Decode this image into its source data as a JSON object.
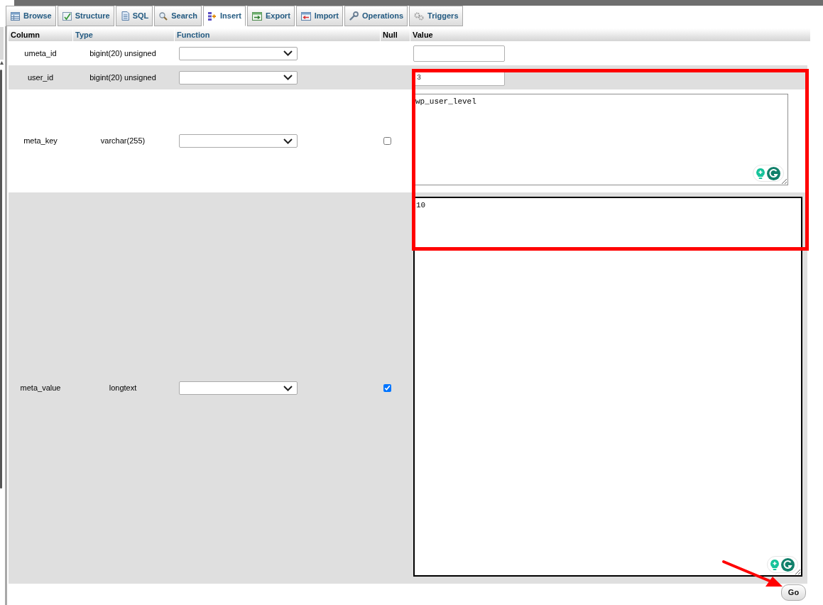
{
  "tabs": [
    {
      "label": "Browse",
      "selected": false
    },
    {
      "label": "Structure",
      "selected": false
    },
    {
      "label": "SQL",
      "selected": false
    },
    {
      "label": "Search",
      "selected": false
    },
    {
      "label": "Insert",
      "selected": true
    },
    {
      "label": "Export",
      "selected": false
    },
    {
      "label": "Import",
      "selected": false
    },
    {
      "label": "Operations",
      "selected": false
    },
    {
      "label": "Triggers",
      "selected": false
    }
  ],
  "table": {
    "columns": [
      {
        "label": "Column",
        "link": false
      },
      {
        "label": "Type",
        "link": true
      },
      {
        "label": "Function",
        "link": true
      },
      {
        "label": "Null",
        "link": false
      },
      {
        "label": "Value",
        "link": false
      }
    ],
    "rows": [
      {
        "column": "umeta_id",
        "type": "bigint(20) unsigned",
        "kind": "input",
        "focused": false
      },
      {
        "column": "user_id",
        "type": "bigint(20) unsigned",
        "kind": "input",
        "value": "3",
        "focused": false
      },
      {
        "column": "meta_key",
        "type": "varchar(255)",
        "kind": "textarea",
        "null_checked": false,
        "value": "wp_user_level",
        "focused": false
      },
      {
        "column": "meta_value",
        "type": "longtext",
        "kind": "textarea",
        "null_checked": true,
        "value": "10",
        "focused": true
      }
    ]
  },
  "buttons": [
    {
      "label": "Go"
    }
  ]
}
